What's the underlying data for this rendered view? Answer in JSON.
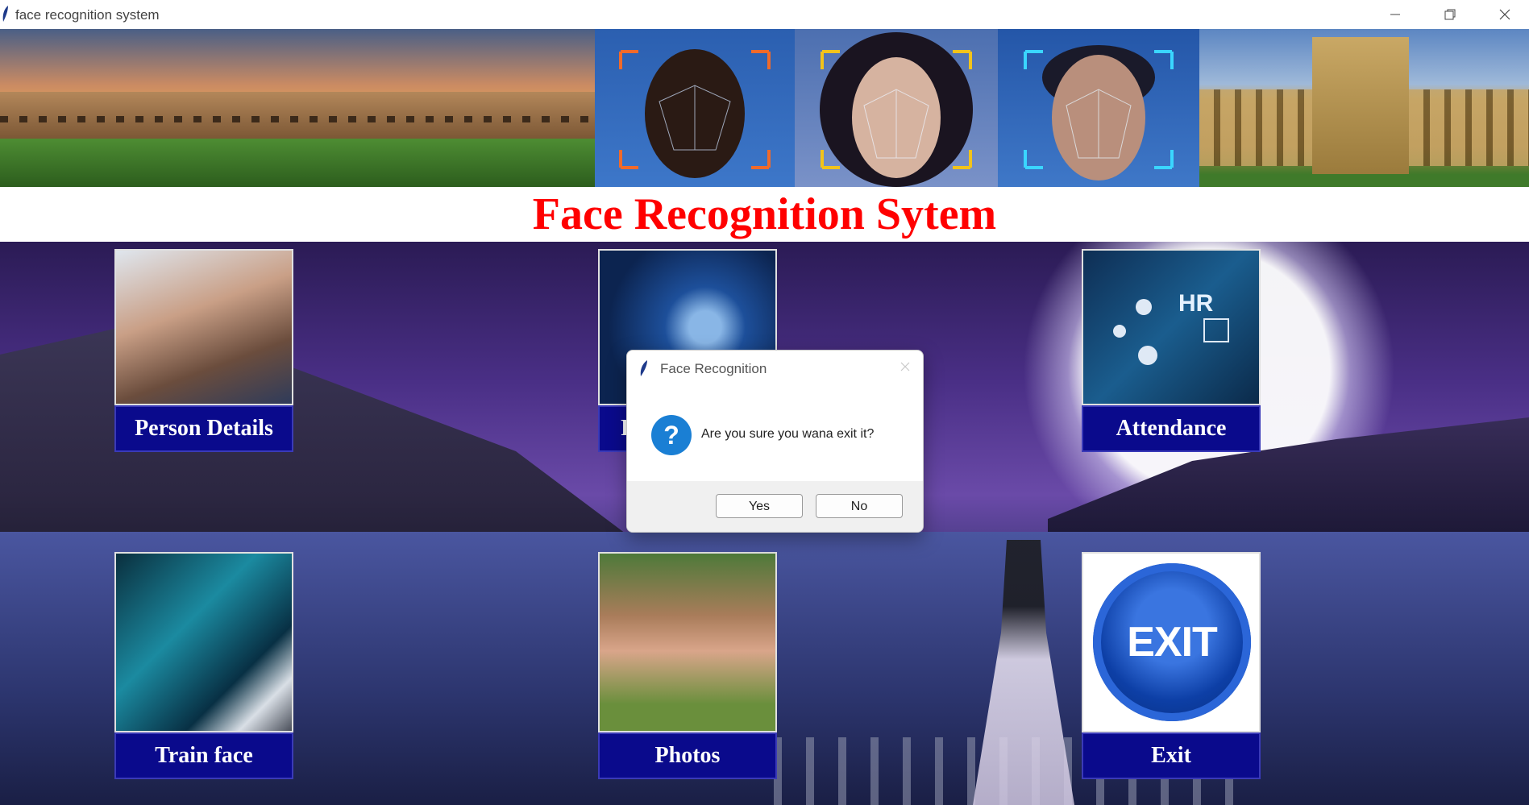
{
  "window": {
    "title": "face recognition system",
    "controls": [
      "minimize-icon",
      "restore-icon",
      "close-icon"
    ]
  },
  "header": {
    "headline": "Face Recognition Sytem",
    "headline_color": "#ff0000"
  },
  "tiles": [
    {
      "label": "Person Details"
    },
    {
      "label": "Face Detector"
    },
    {
      "label": "Attendance"
    },
    {
      "label": "Train face"
    },
    {
      "label": "Photos"
    },
    {
      "label": "Exit",
      "image_text": "EXIT"
    }
  ],
  "dialog": {
    "title": "Face Recognition",
    "message": "Are you sure you wana exit it?",
    "icon": "question-icon",
    "yes_label": "Yes",
    "no_label": "No"
  },
  "colors": {
    "tile_label_bg": "#0a0a8c",
    "question_icon": "#1a7fd4"
  }
}
